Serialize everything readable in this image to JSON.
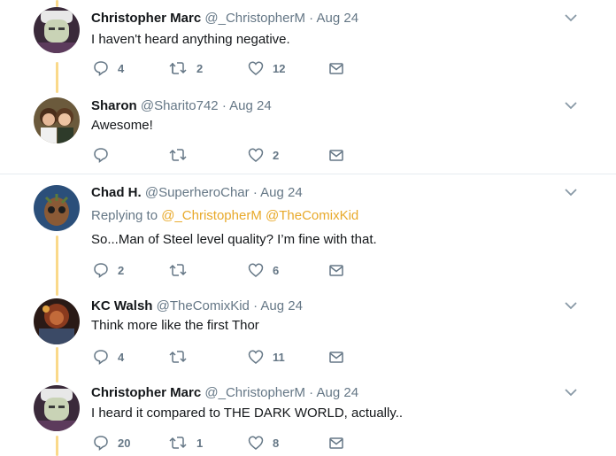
{
  "colors": {
    "accent": "#e8a92a",
    "muted": "#657786",
    "thread_line": "#fad98a"
  },
  "tweets": [
    {
      "name": "Christopher Marc",
      "handle": "@_ChristopherM",
      "sep": "·",
      "date": "Aug 24",
      "text": "I haven't heard anything negative.",
      "reply_count": "4",
      "retweet_count": "2",
      "like_count": "12"
    },
    {
      "name": "Sharon",
      "handle": "@Sharito742",
      "sep": "·",
      "date": "Aug 24",
      "text": "Awesome!",
      "reply_count": "",
      "retweet_count": "",
      "like_count": "2"
    },
    {
      "name": "Chad H.",
      "handle": "@SuperheroChar",
      "sep": "·",
      "date": "Aug 24",
      "replying_prefix": "Replying to",
      "replying_to": [
        "@_ChristopherM",
        "@TheComixKid"
      ],
      "text": "So...Man of Steel level quality? I’m fine with that.",
      "reply_count": "2",
      "retweet_count": "",
      "like_count": "6"
    },
    {
      "name": "KC Walsh",
      "handle": "@TheComixKid",
      "sep": "·",
      "date": "Aug 24",
      "text": "Think more like the first Thor",
      "reply_count": "4",
      "retweet_count": "",
      "like_count": "11"
    },
    {
      "name": "Christopher Marc",
      "handle": "@_ChristopherM",
      "sep": "·",
      "date": "Aug 24",
      "text": "I heard it compared to THE DARK WORLD, actually..",
      "reply_count": "20",
      "retweet_count": "1",
      "like_count": "8"
    }
  ]
}
